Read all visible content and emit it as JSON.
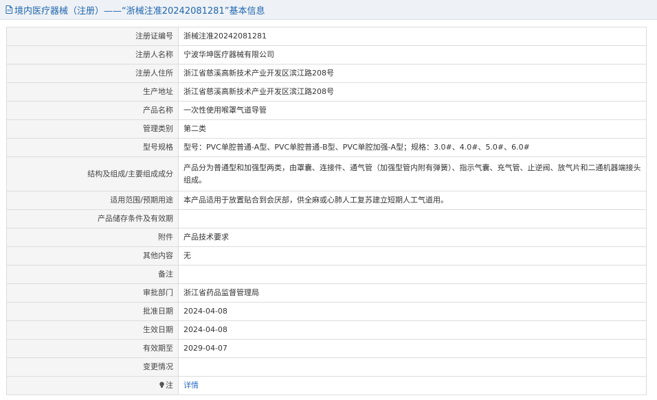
{
  "header": {
    "title": "境内医疗器械（注册）——“浙械注准20242081281”基本信息",
    "icon": "document-icon"
  },
  "rows": [
    {
      "label": "注册证编号",
      "value": "浙械注准20242081281"
    },
    {
      "label": "注册人名称",
      "value": "宁波华坤医疗器械有限公司"
    },
    {
      "label": "注册人住所",
      "value": "浙江省慈溪高新技术产业开发区滨江路208号"
    },
    {
      "label": "生产地址",
      "value": "浙江省慈溪高新技术产业开发区滨江路208号"
    },
    {
      "label": "产品名称",
      "value": "一次性使用喉罩气道导管"
    },
    {
      "label": "管理类别",
      "value": "第二类"
    },
    {
      "label": "型号规格",
      "value": "型号：PVC单腔普通-A型、PVC单腔普通-B型、PVC单腔加强-A型；规格：3.0#、4.0#、5.0#、6.0#"
    },
    {
      "label": "结构及组成/主要组成成分",
      "value": "产品分为普通型和加强型两类，由罩囊、连接件、通气管（加强型管内附有弹簧）、指示气囊、充气管、止逆阀、放气片和二通机器端接头组成。"
    },
    {
      "label": "适用范围/预期用途",
      "value": "本产品适用于放置贴合到会厌部，供全麻或心肺人工复苏建立短期人工气道用。"
    },
    {
      "label": "产品储存条件及有效期",
      "value": ""
    },
    {
      "label": "附件",
      "value": "产品技术要求"
    },
    {
      "label": "其他内容",
      "value": "无"
    },
    {
      "label": "备注",
      "value": ""
    },
    {
      "label": "审批部门",
      "value": "浙江省药品监督管理局"
    },
    {
      "label": "批准日期",
      "value": "2024-04-08"
    },
    {
      "label": "生效日期",
      "value": "2024-04-08"
    },
    {
      "label": "有效期至",
      "value": "2029-04-07"
    },
    {
      "label": "变更情况",
      "value": ""
    }
  ],
  "note": {
    "label": "注",
    "icon": "bulb-icon",
    "link_text": "详情"
  }
}
